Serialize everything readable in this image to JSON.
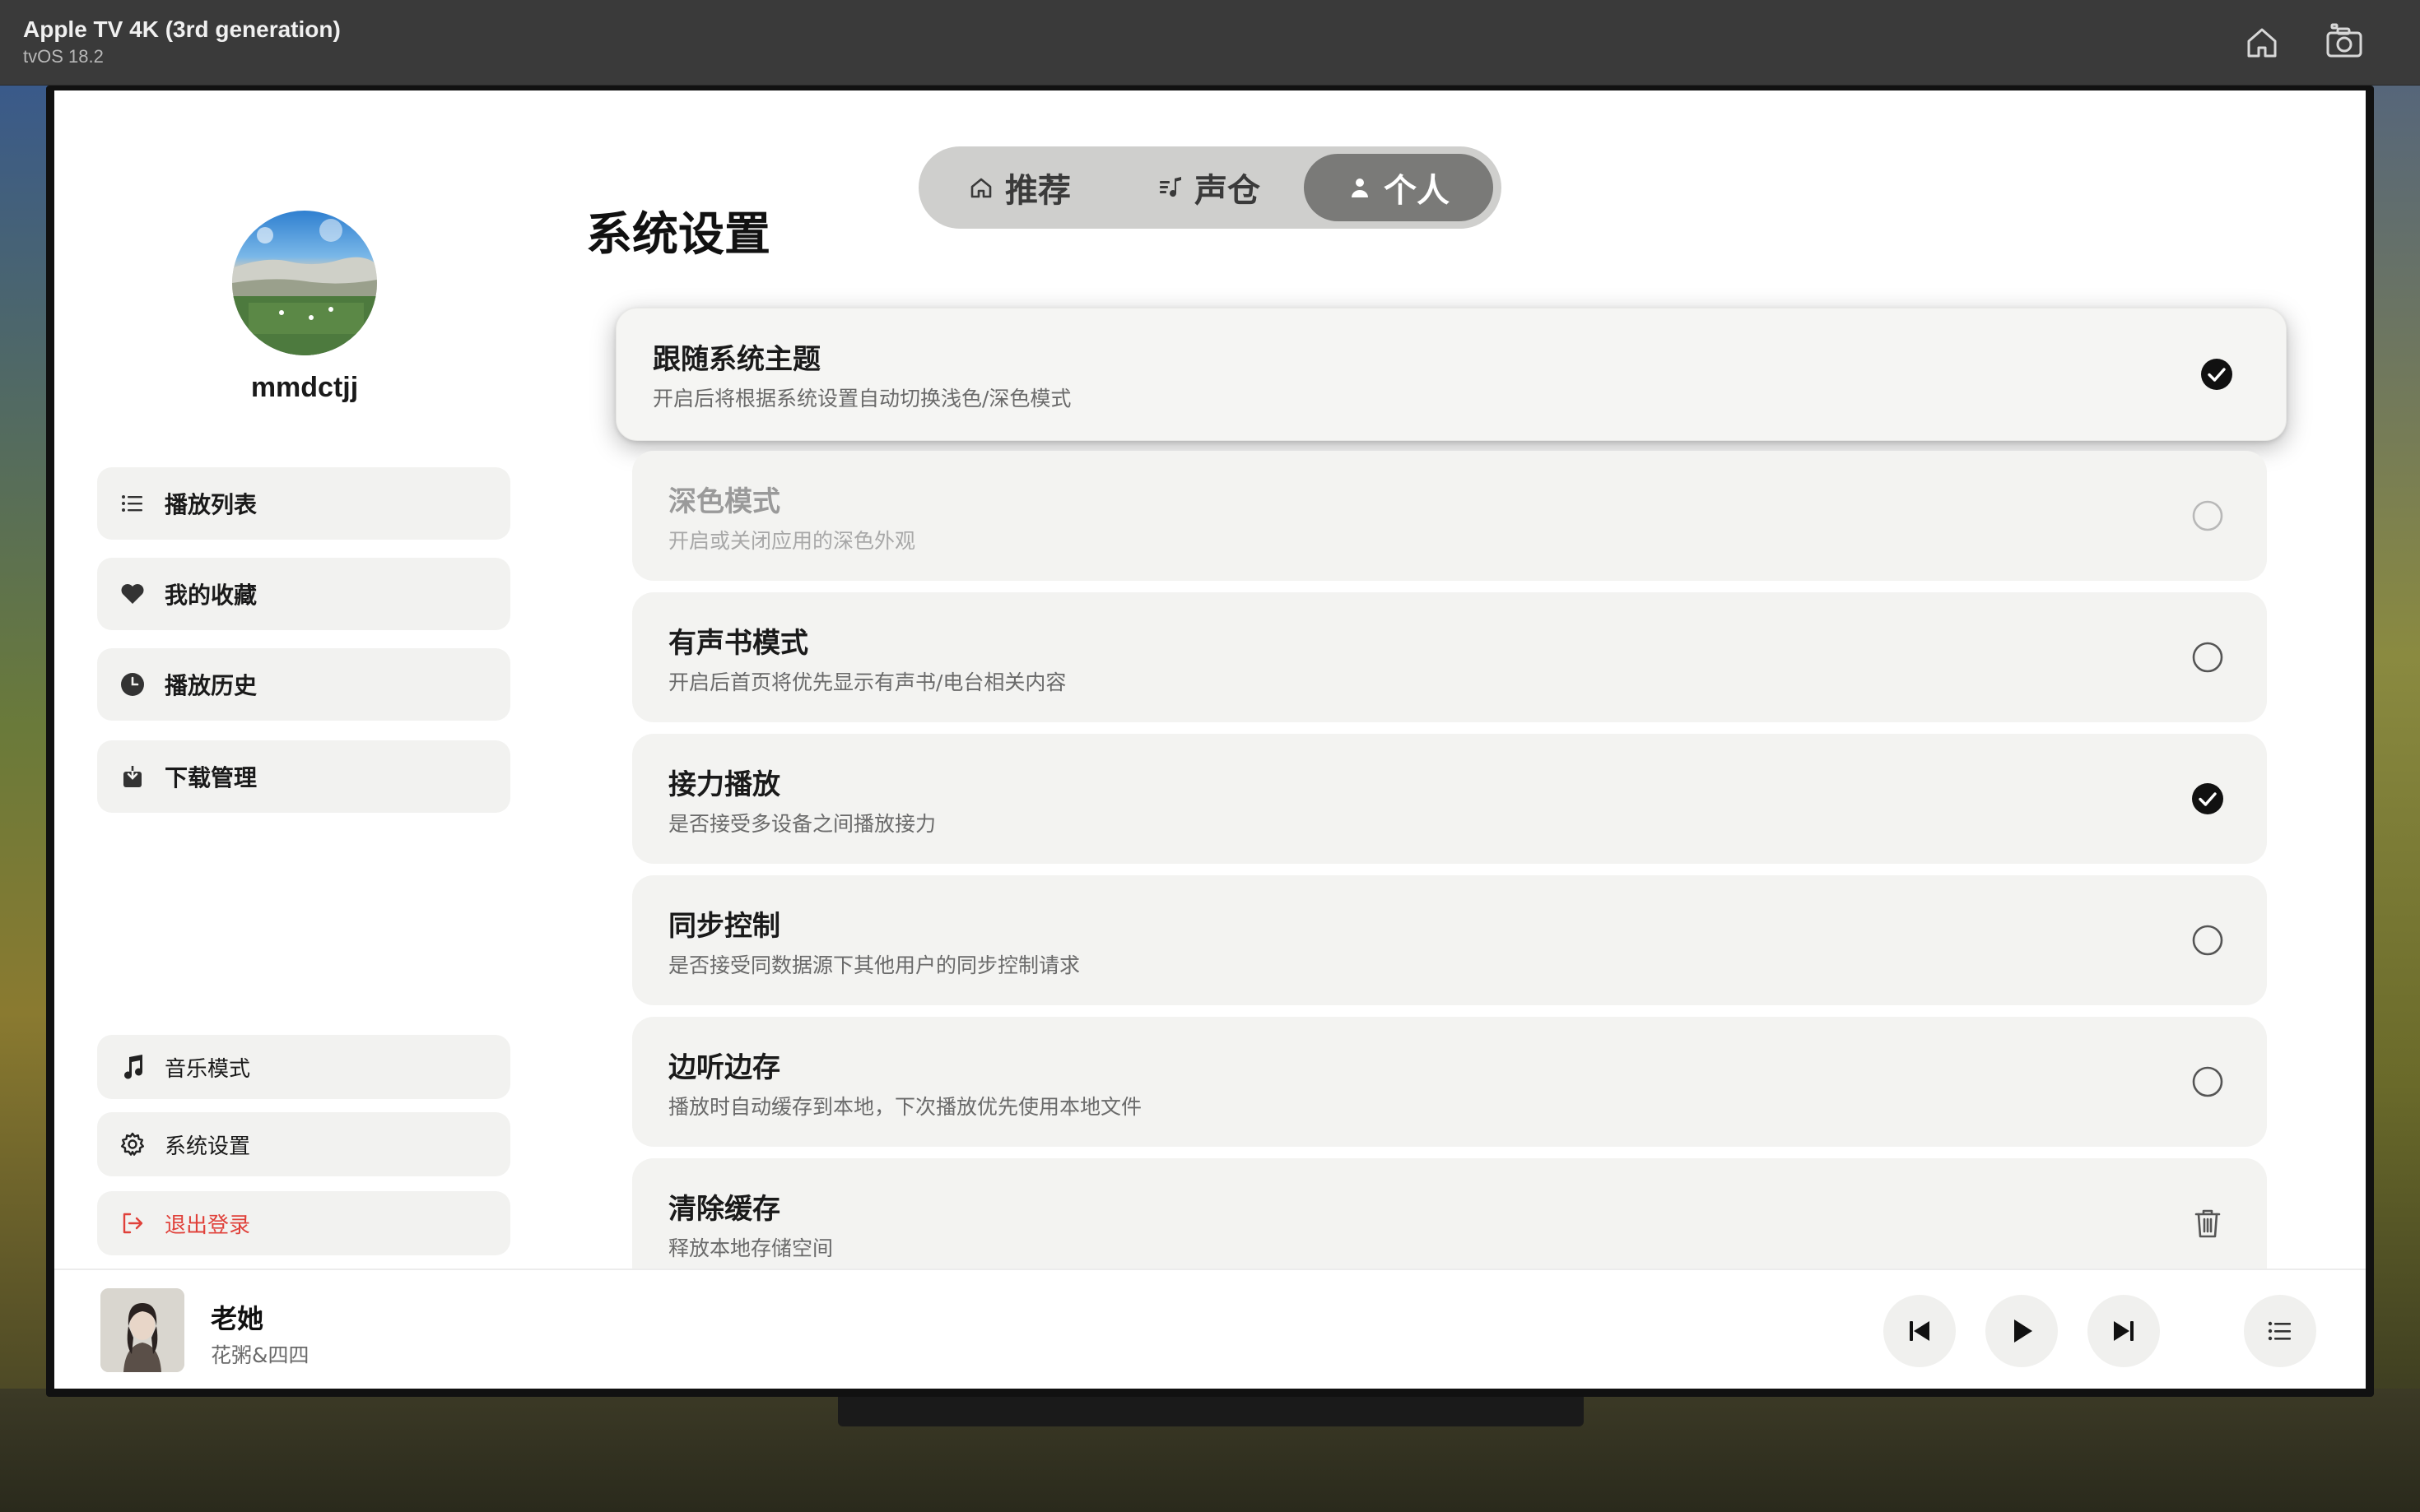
{
  "simulator": {
    "device": "Apple TV 4K (3rd generation)",
    "os": "tvOS 18.2",
    "icons": [
      "home-icon",
      "screenshot-icon"
    ]
  },
  "tabs": [
    {
      "label": "推荐",
      "icon": "home-icon",
      "active": false
    },
    {
      "label": "声仓",
      "icon": "music-list-icon",
      "active": false
    },
    {
      "label": "个人",
      "icon": "person-icon",
      "active": true
    }
  ],
  "profile": {
    "username": "mmdctjj"
  },
  "sidebar": {
    "items": [
      {
        "label": "播放列表",
        "icon": "list-icon"
      },
      {
        "label": "我的收藏",
        "icon": "heart-icon"
      },
      {
        "label": "播放历史",
        "icon": "clock-icon"
      },
      {
        "label": "下载管理",
        "icon": "download-icon"
      }
    ],
    "bottom_items": [
      {
        "label": "音乐模式",
        "icon": "music-note-icon"
      },
      {
        "label": "系统设置",
        "icon": "gear-icon"
      },
      {
        "label": "退出登录",
        "icon": "logout-icon",
        "color": "#e0413a"
      }
    ]
  },
  "page": {
    "title": "系统设置"
  },
  "settings": [
    {
      "title": "跟随系统主题",
      "desc": "开启后将根据系统设置自动切换浅色/深色模式",
      "control": "checked",
      "focused": true
    },
    {
      "title": "深色模式",
      "desc": "开启或关闭应用的深色外观",
      "control": "unchecked",
      "disabled": true
    },
    {
      "title": "有声书模式",
      "desc": "开启后首页将优先显示有声书/电台相关内容",
      "control": "unchecked"
    },
    {
      "title": "接力播放",
      "desc": "是否接受多设备之间播放接力",
      "control": "checked"
    },
    {
      "title": "同步控制",
      "desc": "是否接受同数据源下其他用户的同步控制请求",
      "control": "unchecked"
    },
    {
      "title": "边听边存",
      "desc": "播放时自动缓存到本地，下次播放优先使用本地文件",
      "control": "unchecked"
    },
    {
      "title": "清除缓存",
      "desc": "释放本地存储空间",
      "control": "trash-icon"
    }
  ],
  "player": {
    "title": "老她",
    "artist": "花粥&四四",
    "controls": [
      "previous-icon",
      "play-icon",
      "next-icon",
      "queue-list-icon"
    ]
  },
  "colors": {
    "active_tab": "#7a7a78",
    "danger": "#e0413a",
    "card_bg": "#f3f3f1"
  }
}
